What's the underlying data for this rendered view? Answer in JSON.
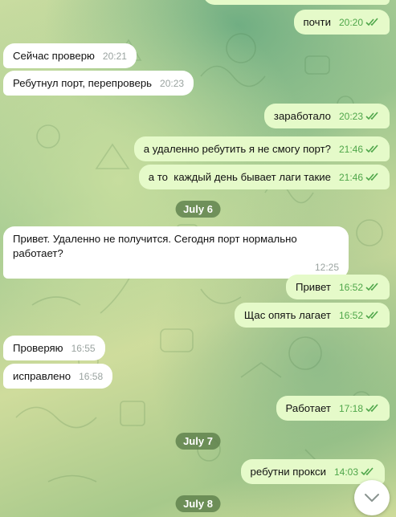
{
  "messages": [
    {
      "dir": "out",
      "text": "почти",
      "time": "20:20"
    },
    {
      "dir": "in",
      "text": "Сейчас проверю",
      "time": "20:21"
    },
    {
      "dir": "in",
      "text": "Ребутнул порт, перепроверь",
      "time": "20:23"
    },
    {
      "dir": "out",
      "text": "заработало",
      "time": "20:23"
    },
    {
      "dir": "out",
      "text": "а удаленно ребутить я не смогу порт?",
      "time": "21:46"
    },
    {
      "dir": "out",
      "text": "а то  каждый день бывает лаги такие",
      "time": "21:46"
    },
    {
      "dir": "in",
      "text": "Привет. Удаленно не получится. Сегодня порт нормально работает?",
      "time": "12:25"
    },
    {
      "dir": "out",
      "text": "Привет",
      "time": "16:52"
    },
    {
      "dir": "out",
      "text": "Щас опять лагает",
      "time": "16:52"
    },
    {
      "dir": "in",
      "text": "Проверяю",
      "time": "16:55"
    },
    {
      "dir": "in",
      "text": "исправлено",
      "time": "16:58"
    },
    {
      "dir": "out",
      "text": "Работает",
      "time": "17:18"
    },
    {
      "dir": "out",
      "text": "ребутни прокси",
      "time": "14:03"
    }
  ],
  "dates": [
    "July 6",
    "July 7",
    "July 8"
  ],
  "scroll_button": {
    "icon": "chevron-down-icon"
  },
  "colors": {
    "incoming": "#ffffff",
    "outgoing": "#e5fac9",
    "time_out": "#4fa64a",
    "date_badge": "#5e804c"
  }
}
